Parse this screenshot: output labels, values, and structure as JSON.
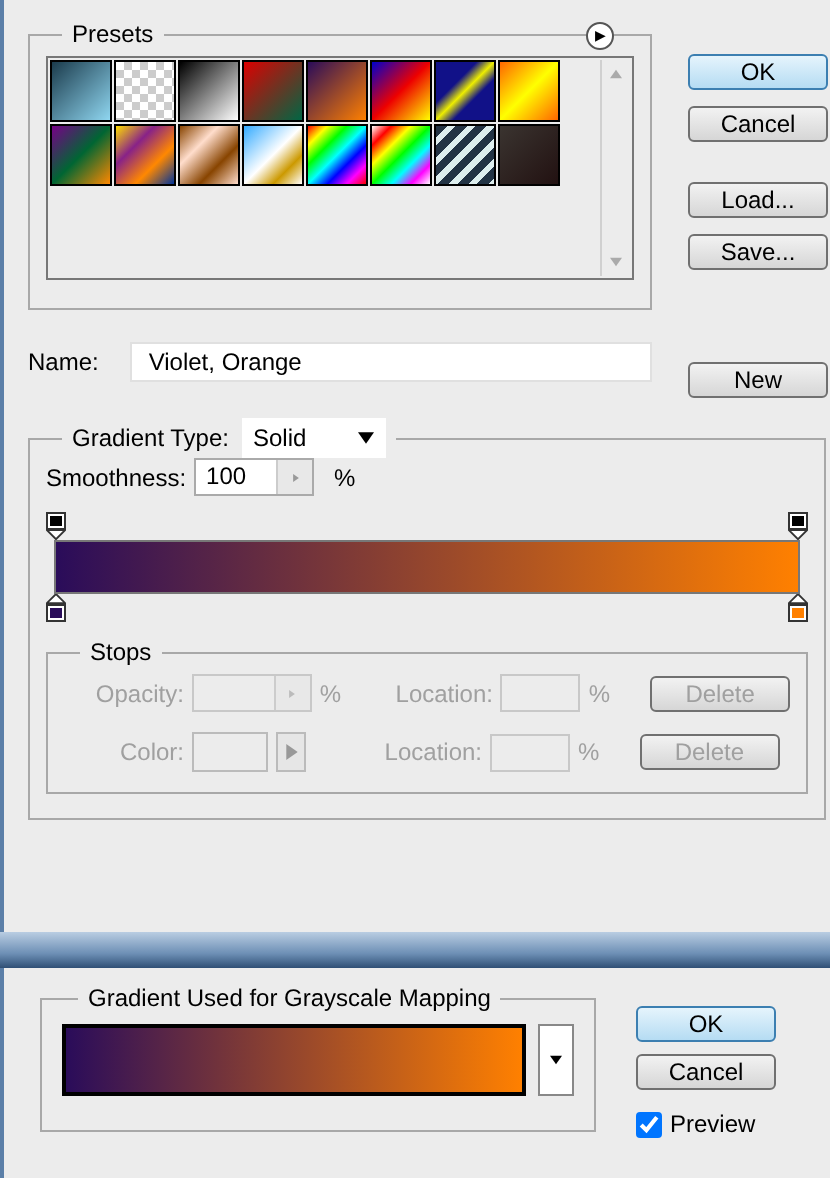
{
  "gradient_editor": {
    "presets": {
      "title": "Presets",
      "menu_button": "▶"
    },
    "buttons": [
      {
        "label": "OK",
        "kind": "default"
      },
      {
        "label": "Cancel",
        "kind": "normal"
      },
      {
        "label": "Load...",
        "kind": "normal"
      },
      {
        "label": "Save...",
        "kind": "normal"
      }
    ],
    "name": {
      "label": "Name:",
      "value": "Violet, Orange"
    },
    "new_button": "New",
    "gradient_type": {
      "label": "Gradient Type:",
      "value": "Solid"
    },
    "smoothness": {
      "label": "Smoothness:",
      "value": "100",
      "unit": "%"
    },
    "opacity_stops": [
      {
        "color": "#000000"
      },
      {
        "color": "#000000"
      }
    ],
    "color_stops": [
      {
        "color": "#2a0c5a"
      },
      {
        "color": "#ff8000"
      }
    ],
    "stops": {
      "title": "Stops",
      "disabled": true,
      "rows": [
        {
          "label": "Opacity:",
          "kind": "opacity",
          "unit": "%",
          "location_label": "Location:",
          "location_unit": "%",
          "delete": "Delete"
        },
        {
          "label": "Color:",
          "kind": "color",
          "location_label": "Location:",
          "location_unit": "%",
          "delete": "Delete"
        }
      ]
    }
  },
  "gradient_map": {
    "group_title": "Gradient Used for Grayscale Mapping",
    "buttons": [
      {
        "label": "OK",
        "kind": "default"
      },
      {
        "label": "Cancel",
        "kind": "normal"
      }
    ],
    "preview": {
      "label": "Preview",
      "checked": true
    }
  }
}
